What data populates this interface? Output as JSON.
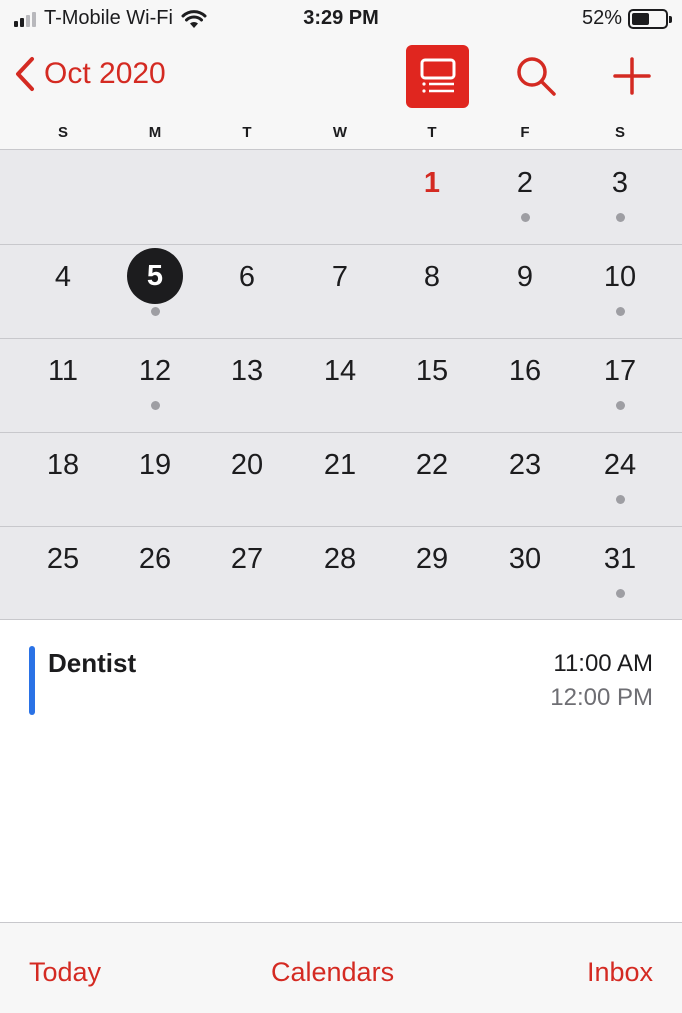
{
  "status_bar": {
    "carrier": "T-Mobile Wi-Fi",
    "time": "3:29 PM",
    "battery_percent": "52%",
    "battery_level": 0.52,
    "signal_icon": "cellular-signal-icon",
    "wifi_icon": "wifi-icon",
    "battery_icon": "battery-icon"
  },
  "nav": {
    "back_label": "Oct 2020",
    "back_icon": "chevron-left-icon",
    "list_view_icon": "list-view-icon",
    "search_icon": "search-icon",
    "add_icon": "plus-icon"
  },
  "weekdays": [
    "S",
    "M",
    "T",
    "W",
    "T",
    "F",
    "S"
  ],
  "calendar": {
    "weeks": [
      [
        null,
        null,
        null,
        null,
        {
          "day": "1",
          "dot": false,
          "today": true
        },
        {
          "day": "2",
          "dot": true
        },
        {
          "day": "3",
          "dot": true
        }
      ],
      [
        {
          "day": "4",
          "dot": false
        },
        {
          "day": "5",
          "dot": true,
          "selected": true
        },
        {
          "day": "6",
          "dot": false
        },
        {
          "day": "7",
          "dot": false
        },
        {
          "day": "8",
          "dot": false
        },
        {
          "day": "9",
          "dot": false
        },
        {
          "day": "10",
          "dot": true
        }
      ],
      [
        {
          "day": "11",
          "dot": false
        },
        {
          "day": "12",
          "dot": true
        },
        {
          "day": "13",
          "dot": false
        },
        {
          "day": "14",
          "dot": false
        },
        {
          "day": "15",
          "dot": false
        },
        {
          "day": "16",
          "dot": false
        },
        {
          "day": "17",
          "dot": true
        }
      ],
      [
        {
          "day": "18",
          "dot": false
        },
        {
          "day": "19",
          "dot": false
        },
        {
          "day": "20",
          "dot": false
        },
        {
          "day": "21",
          "dot": false
        },
        {
          "day": "22",
          "dot": false
        },
        {
          "day": "23",
          "dot": false
        },
        {
          "day": "24",
          "dot": true
        }
      ],
      [
        {
          "day": "25",
          "dot": false
        },
        {
          "day": "26",
          "dot": false
        },
        {
          "day": "27",
          "dot": false
        },
        {
          "day": "28",
          "dot": false
        },
        {
          "day": "29",
          "dot": false
        },
        {
          "day": "30",
          "dot": false
        },
        {
          "day": "31",
          "dot": true
        }
      ]
    ]
  },
  "events": [
    {
      "title": "Dentist",
      "start": "11:00 AM",
      "end": "12:00 PM",
      "color": "#2a72e6"
    }
  ],
  "tab_bar": {
    "today": "Today",
    "calendars": "Calendars",
    "inbox": "Inbox"
  },
  "colors": {
    "accent": "#d42a22",
    "selected_day_bg": "#1c1c1e",
    "event_dot": "#9e9ea3",
    "grid_bg": "#e9e9ec"
  }
}
